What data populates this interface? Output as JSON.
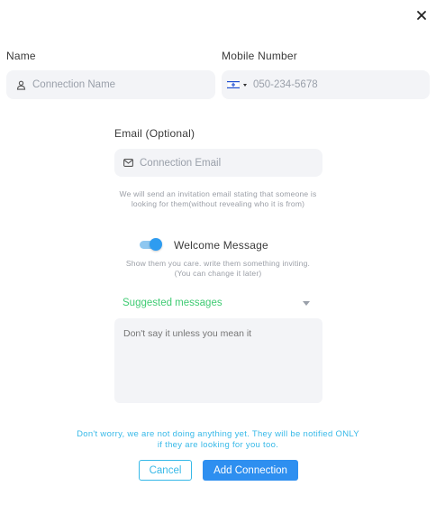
{
  "dialog": {
    "close_icon": "close-icon"
  },
  "name": {
    "label": "Name",
    "placeholder": "Connection Name",
    "icon": "person-icon"
  },
  "mobile": {
    "label": "Mobile Number",
    "placeholder": "050-234-5678",
    "country_flag": "israel-flag-icon"
  },
  "email": {
    "label": "Email (Optional)",
    "placeholder": "Connection Email",
    "icon": "mail-icon",
    "note_line1": "We will send an invitation email stating that someone is",
    "note_line2": "looking for them(without revealing who it is from)"
  },
  "welcome": {
    "toggle_on": true,
    "label": "Welcome Message",
    "note_line1": "Show them you care. write them something inviting.",
    "note_line2": "(You can change it later)"
  },
  "suggested": {
    "label": "Suggested messages"
  },
  "message": {
    "placeholder": "Don't say it unless you mean it"
  },
  "footer": {
    "note_line1": "Don't worry, we are not doing anything yet. They will be notified ONLY",
    "note_line2": "if they are looking for you too.",
    "cancel_label": "Cancel",
    "add_label": "Add Connection"
  },
  "colors": {
    "accent_blue": "#2e8ff0",
    "cyan": "#37b9e8",
    "green": "#3fcb73",
    "field_bg": "#f3f4f7"
  }
}
